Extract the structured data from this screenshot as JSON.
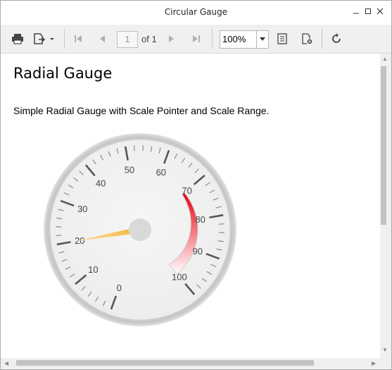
{
  "window": {
    "title": "Circular Gauge"
  },
  "toolbar": {
    "page_number": "1",
    "page_of": "of 1",
    "zoom": "100%"
  },
  "report": {
    "heading": "Radial Gauge",
    "description": "Simple Radial Gauge with Scale Pointer and Scale Range."
  },
  "gauge": {
    "scale_min": 0,
    "scale_max": 100,
    "labels": [
      "0",
      "10",
      "20",
      "30",
      "40",
      "50",
      "60",
      "70",
      "80",
      "90",
      "100"
    ],
    "pointer_value": 20,
    "range_start": 70,
    "range_end": 100,
    "colors": {
      "pointer": "#f5b335",
      "range_high": "#e8000c",
      "range_low": "#ffffff",
      "bezel": "#cfcfcf",
      "face": "#f2f2f2"
    }
  }
}
